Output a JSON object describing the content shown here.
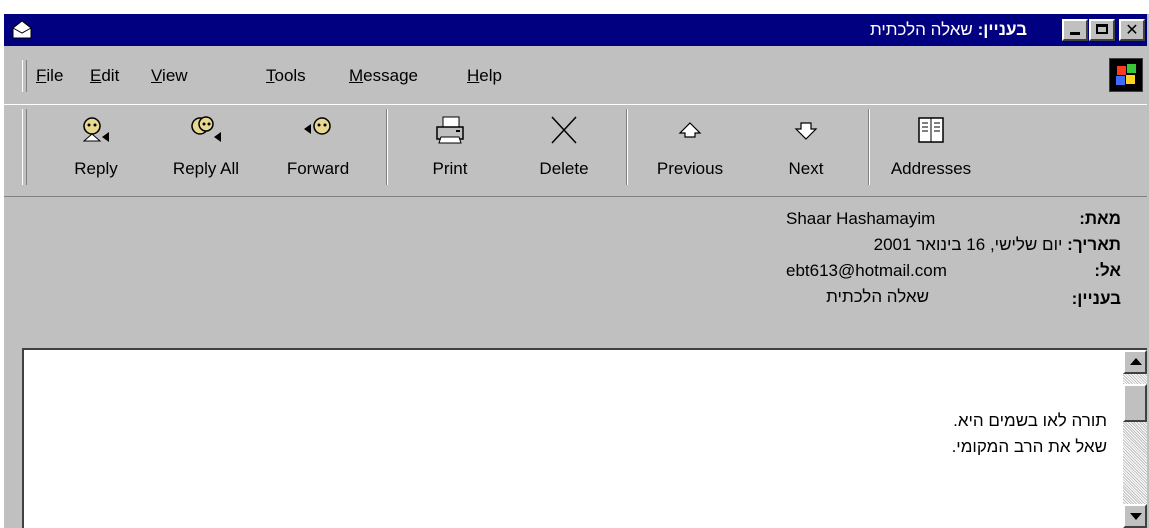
{
  "window": {
    "title_label": "בעניין:",
    "title_value": "שאלה הלכתית",
    "minimize_label": "",
    "maximize_label": "",
    "close_label": "✕"
  },
  "menu": {
    "items": [
      {
        "accel": "F",
        "rest": "ile"
      },
      {
        "accel": "E",
        "rest": "dit"
      },
      {
        "accel": "V",
        "rest": "iew"
      },
      {
        "accel": "T",
        "rest": "ools"
      },
      {
        "accel": "M",
        "rest": "essage"
      },
      {
        "accel": "H",
        "rest": "elp"
      }
    ]
  },
  "toolbar": {
    "reply": "Reply",
    "reply_all": "Reply All",
    "forward": "Forward",
    "print": "Print",
    "delete": "Delete",
    "previous": "Previous",
    "next": "Next",
    "addresses": "Addresses"
  },
  "headers": {
    "from_label": "מאת:",
    "from_value": "Shaar Hashamayim",
    "date_label": "תאריך:",
    "date_value": "יום שלישי, 16 בינואר 2001",
    "to_label": "אל:",
    "to_value": "ebt613@hotmail.com",
    "subject_label": "בעניין:",
    "subject_value": "שאלה הלכתית"
  },
  "body": {
    "line1": "תורה לאו בשמים היא.",
    "line2": "שאל את הרב המקומי."
  },
  "colors": {
    "titlebar": "#000080",
    "face": "#c0c0c0"
  }
}
